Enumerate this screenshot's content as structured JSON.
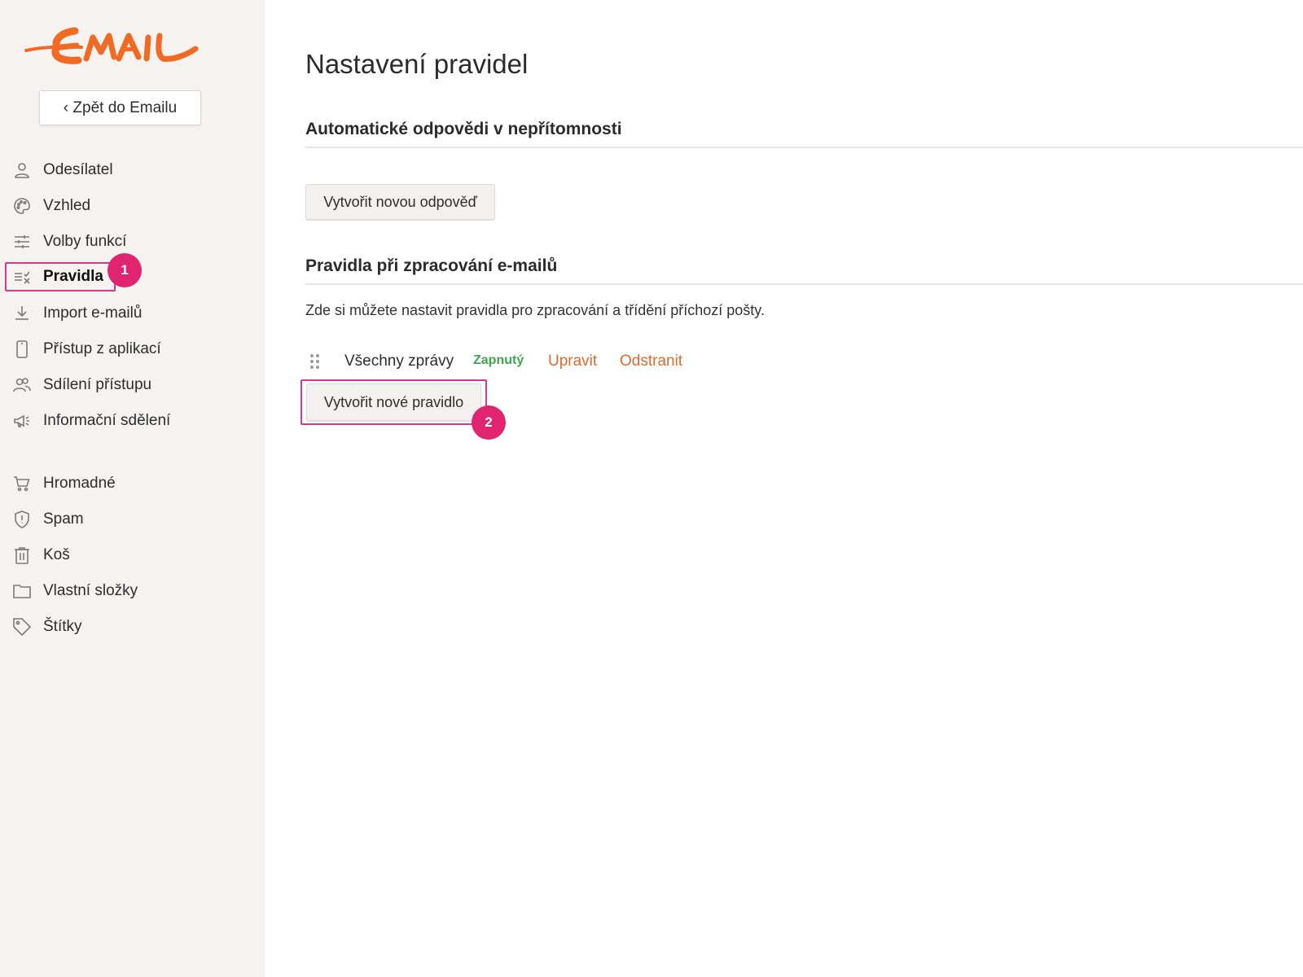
{
  "brand": {
    "logo_text": "EMAIL",
    "logo_color": "#f06a24"
  },
  "sidebar": {
    "back_button_label": "‹ Zpět do Emailu",
    "items": [
      {
        "label": "Odesílatel",
        "icon": "user-icon"
      },
      {
        "label": "Vzhled",
        "icon": "palette-icon"
      },
      {
        "label": "Volby funkcí",
        "icon": "sliders-icon"
      },
      {
        "label": "Pravidla",
        "icon": "rules-icon",
        "active": true
      },
      {
        "label": "Import e-mailů",
        "icon": "download-icon"
      },
      {
        "label": "Přístup z aplikací",
        "icon": "phone-icon"
      },
      {
        "label": "Sdílení přístupu",
        "icon": "users-icon"
      },
      {
        "label": "Informační sdělení",
        "icon": "megaphone-icon"
      },
      {
        "label": "Hromadné",
        "icon": "cart-icon"
      },
      {
        "label": "Spam",
        "icon": "shield-icon"
      },
      {
        "label": "Koš",
        "icon": "trash-icon"
      },
      {
        "label": "Vlastní složky",
        "icon": "folder-icon"
      },
      {
        "label": "Štítky",
        "icon": "tag-icon"
      }
    ]
  },
  "annotations": {
    "badge_1": "1",
    "badge_2": "2",
    "highlight_color": "#d63a86",
    "badge_color": "#e0246f"
  },
  "main": {
    "title": "Nastavení pravidel",
    "autoreply": {
      "heading": "Automatické odpovědi v nepřítomnosti",
      "create_button": "Vytvořit novou odpověď"
    },
    "rules": {
      "heading": "Pravidla při zpracování e-mailů",
      "description": "Zde si můžete nastavit pravidla pro zpracování a třídění příchozí pošty.",
      "list": [
        {
          "name": "Všechny zprávy",
          "status": "Zapnutý",
          "edit_label": "Upravit",
          "delete_label": "Odstranit"
        }
      ],
      "create_button": "Vytvořit nové pravidlo"
    },
    "colors": {
      "status_on": "#3fa64f",
      "link": "#e06a2c"
    }
  }
}
